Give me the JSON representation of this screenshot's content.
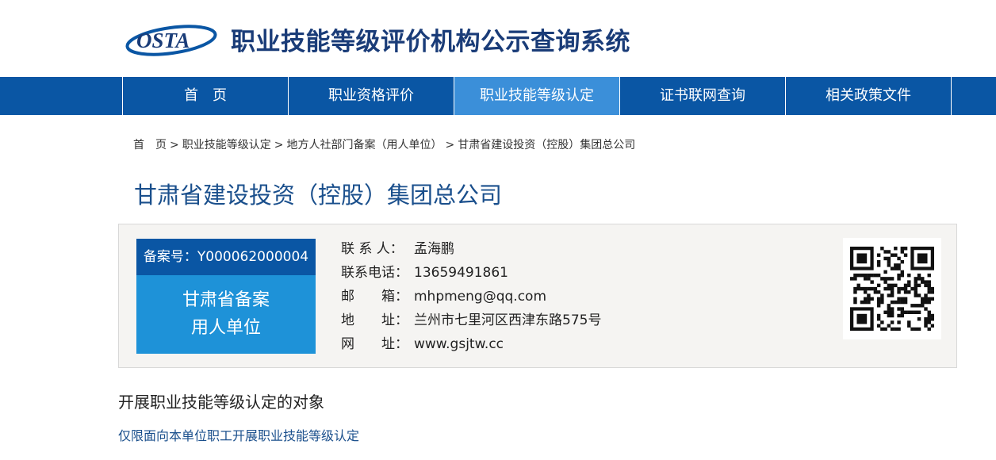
{
  "header": {
    "logo_text": "OSTA",
    "title": "职业技能等级评价机构公示查询系统",
    "brand_color": "#1a3c78"
  },
  "nav": {
    "items": [
      {
        "label": "首　页",
        "active": false
      },
      {
        "label": "职业资格评价",
        "active": false
      },
      {
        "label": "职业技能等级认定",
        "active": true
      },
      {
        "label": "证书联网查询",
        "active": false
      },
      {
        "label": "相关政策文件",
        "active": false
      }
    ],
    "bg_color": "#0a56a4",
    "active_color": "#3b8fd9"
  },
  "breadcrumb": [
    {
      "label": "首　页"
    },
    {
      "label": "职业技能等级认定"
    },
    {
      "label": "地方人社部门备案（用人单位）"
    },
    {
      "label": "甘肃省建设投资（控股）集团总公司"
    }
  ],
  "org": {
    "title": "甘肃省建设投资（控股）集团总公司",
    "badge": {
      "record_no": "备案号：Y000062000004",
      "line1": "甘肃省备案",
      "line2": "用人单位"
    },
    "contact": [
      {
        "label": "联 系 人：",
        "value": "孟海鹏"
      },
      {
        "label": "联系电话：",
        "value": "13659491861"
      },
      {
        "label": "邮　　箱：",
        "value": "mhpmeng@qq.com"
      },
      {
        "label": "地　　址：",
        "value": "兰州市七里河区西津东路575号"
      },
      {
        "label": "网　　址：",
        "value": "www.gsjtw.cc"
      }
    ]
  },
  "section": {
    "title": "开展职业技能等级认定的对象",
    "text": "仅限面向本单位职工开展职业技能等级认定"
  }
}
